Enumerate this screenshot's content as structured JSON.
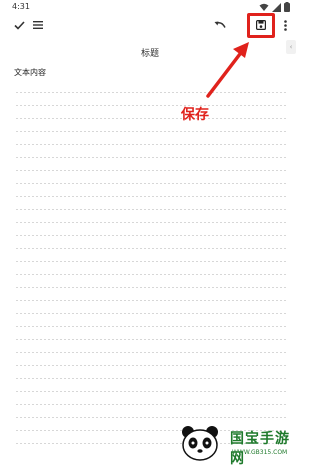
{
  "status_bar": {
    "time": "4:31"
  },
  "toolbar": {
    "icons": {
      "done": "check-icon",
      "menu": "menu-icon",
      "undo": "undo-icon",
      "save": "save-icon",
      "more": "more-vert-icon"
    }
  },
  "note": {
    "title": "标题",
    "content": "文本内容"
  },
  "annotation": {
    "label": "保存",
    "color": "#e0221c"
  },
  "watermark": {
    "title": "国宝手游网",
    "url": "WWW.GB315.COM"
  }
}
